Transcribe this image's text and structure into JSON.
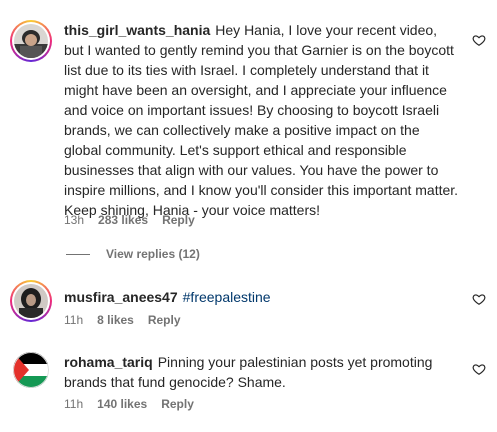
{
  "comments": [
    {
      "username": "this_girl_wants_hania",
      "text": "Hey Hania, I love your recent video, but I wanted to gently remind you that Garnier is on the boycott list due to its ties with Israel. I completely understand that it might have been an oversight, and I appreciate your influence and voice on important issues! By choosing to boycott Israeli brands, we can collectively make a positive impact on the global community. Let's support ethical and responsible businesses that align with our values. You have the power to inspire millions, and I know you'll consider this important matter. Keep shining, Hania - your voice matters!",
      "time": "13h",
      "likes": "283 likes",
      "reply": "Reply",
      "view_replies": "View replies (12)"
    },
    {
      "username": "musfira_anees47",
      "hashtag": "#freepalestine",
      "time": "11h",
      "likes": "8 likes",
      "reply": "Reply"
    },
    {
      "username": "rohama_tariq",
      "text": "Pinning your palestinian posts yet promoting brands that fund genocide? Shame.",
      "time": "11h",
      "likes": "140 likes",
      "reply": "Reply"
    }
  ],
  "icons": {
    "like": "heart-outline-icon"
  },
  "colors": {
    "text": "#262626",
    "secondary": "#737373",
    "hashtag": "#00376b"
  }
}
